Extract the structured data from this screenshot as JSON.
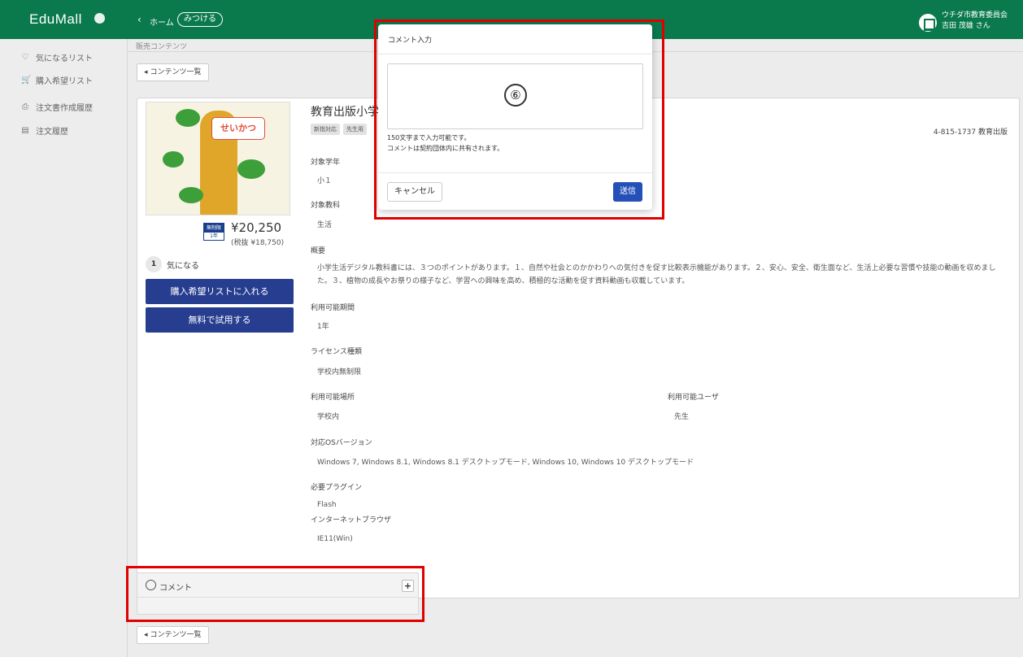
{
  "header": {
    "logo": "EduMall",
    "back": "‹",
    "home": "ホーム",
    "find": "みつける",
    "user_org": "ウチダ市教育委員会",
    "user_name": "吉田 茂雄 さん"
  },
  "sidebar": {
    "items": [
      {
        "icon": "♡",
        "label": "気になるリスト"
      },
      {
        "icon": "🛒",
        "label": "購入希望リスト"
      },
      {
        "icon": "⎙",
        "label": "注文書作成履歴"
      },
      {
        "icon": "▤",
        "label": "注文履歴"
      }
    ]
  },
  "main": {
    "breadcrumb": "販売コンテンツ",
    "back_to_list": "コンテンツ一覧",
    "back_arrow": "◂"
  },
  "product": {
    "cover_title": "せいかつ",
    "badge_top": "無制限",
    "badge_bottom": "1年",
    "price": "¥20,250",
    "price_tax": "(税抜 ¥18,750)",
    "fav_count": "1",
    "fav_label": "気になる",
    "btn_wishlist": "購入希望リストに入れる",
    "btn_trial": "無料で試用する",
    "title": "教育出版小学",
    "tags": [
      "新指対応",
      "先生用"
    ],
    "isbn": "4-815-1737 教育出版",
    "grade_label": "対象学年",
    "grade_value": "小１",
    "subject_label": "対象教科",
    "subject_value": "生活",
    "summary_label": "概要",
    "summary_text": "小学生活デジタル教科書には、３つのポイントがあります。１、自然や社会とのかかわりへの気付きを促す比較表示機能があります。２、安心、安全、衛生面など、生活上必要な習慣や技能の動画を収めました。３、植物の成長やお祭りの様子など、学習への興味を高め、積極的な活動を促す資料動画も収載しています。",
    "period_label": "利用可能期間",
    "period_value": "1年",
    "license_label": "ライセンス種類",
    "license_value": "学校内無制限",
    "place_label": "利用可能場所",
    "place_value": "学校内",
    "user_label": "利用可能ユーザ",
    "user_value": "先生",
    "os_label": "対応OSバージョン",
    "os_value": "Windows 7, Windows 8.1, Windows 8.1 デスクトップモード, Windows 10, Windows 10 デスクトップモード",
    "plugin_label": "必要プラグイン",
    "plugin_value": "Flash",
    "browser_label": "インターネットブラウザ",
    "browser_value": "IE11(Win)"
  },
  "comment": {
    "label": "コメント",
    "add": "+"
  },
  "modal": {
    "title": "コメント入力",
    "marker": "⑥",
    "hint1": "150文字まで入力可能です。",
    "hint2": "コメントは契約団体内に共有されます。",
    "cancel": "キャンセル",
    "send": "送信"
  },
  "colors": {
    "header": "#0a7a4d",
    "primary_button": "#273d8f",
    "send_button": "#2450b8",
    "highlight": "#e00000"
  }
}
